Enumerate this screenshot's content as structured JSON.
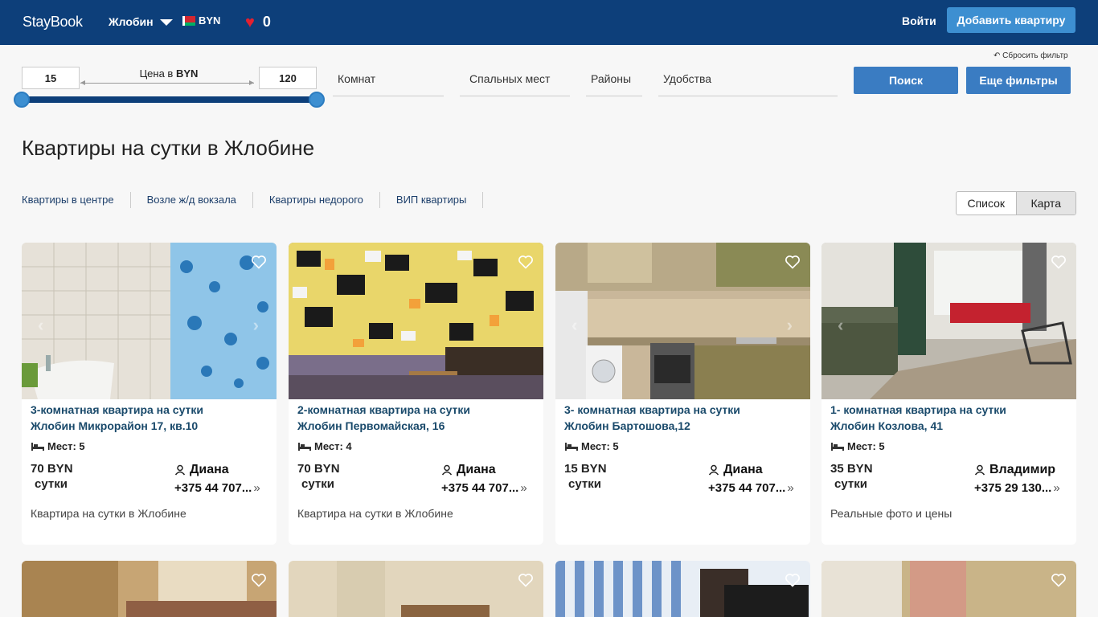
{
  "header": {
    "logo": "StayBook",
    "city": "Жлобин",
    "currency": "BYN",
    "favorites_count": "0",
    "login": "Войти",
    "add_button": "Добавить квартиру"
  },
  "filters": {
    "price_min": "15",
    "price_max": "120",
    "price_label": "Цена в",
    "price_currency": "BYN",
    "rooms": "Комнат",
    "beds": "Спальных мест",
    "districts": "Районы",
    "amenities": "Удобства",
    "reset": "↶ Сбросить фильтр",
    "search": "Поиск",
    "more_filters": "Еще фильтры"
  },
  "page_title": "Квартиры на сутки в Жлобине",
  "quick_links": [
    "Квартиры в центре",
    "Возле ж/д вокзала",
    "Квартиры недорого",
    "ВИП квартиры"
  ],
  "view_toggle": {
    "list": "Список",
    "map": "Карта"
  },
  "listings": [
    {
      "title": "3-комнатная квартира на сутки",
      "address": "Жлобин Микрорайон 17, кв.10",
      "places": "Мест: 5",
      "price": "70 BYN",
      "period": "сутки",
      "owner": "Диана",
      "phone": "+375 44 707...",
      "description": "Квартира на сутки в Жлобине"
    },
    {
      "title": "2-комнатная квартира на сутки",
      "address": "Жлобин Первомайская, 16",
      "places": "Мест: 4",
      "price": "70 BYN",
      "period": "сутки",
      "owner": "Диана",
      "phone": "+375 44 707...",
      "description": "Квартира на сутки в Жлобине"
    },
    {
      "title": "3- комнатная квартира на сутки",
      "address": "Жлобин Бартошова,12",
      "places": "Мест: 5",
      "price": "15 BYN",
      "period": "сутки",
      "owner": "Диана",
      "phone": "+375 44 707...",
      "description": ""
    },
    {
      "title": "1- комнатная квартира на сутки",
      "address": "Жлобин Козлова, 41",
      "places": "Мест: 5",
      "price": "35 BYN",
      "period": "сутки",
      "owner": "Владимир",
      "phone": "+375 29 130...",
      "description": "Реальные фото и цены"
    }
  ],
  "colors": {
    "header_bg": "#0d3f7a",
    "accent": "#3d8fd1",
    "title_link": "#1a4a6b"
  }
}
